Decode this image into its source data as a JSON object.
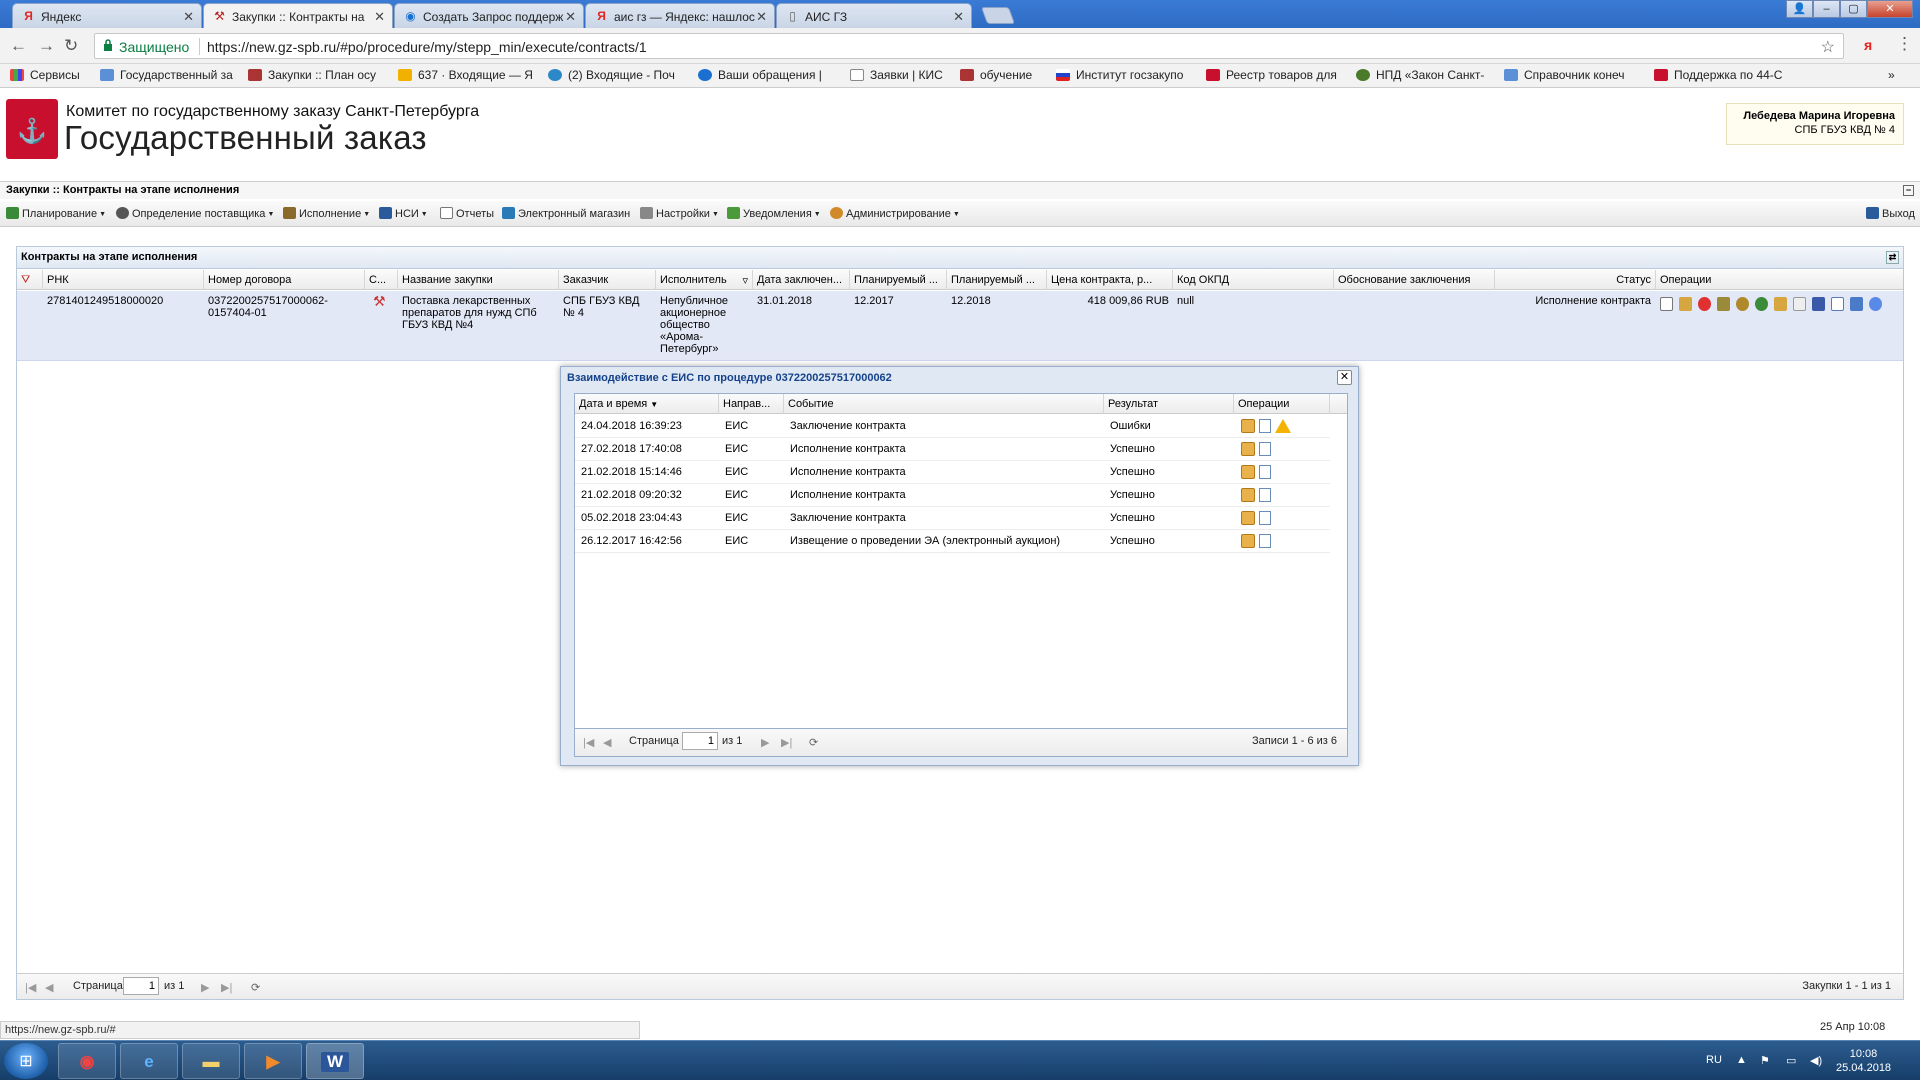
{
  "browser": {
    "tabs": [
      {
        "label": "Яндекс",
        "icon": "yandex-icon"
      },
      {
        "label": "Закупки :: Контракты на",
        "icon": "hammer-icon",
        "active": true
      },
      {
        "label": "Создать Запрос поддерж",
        "icon": "globe-icon"
      },
      {
        "label": "аис гз — Яндекс: нашлоc",
        "icon": "yandex-icon"
      },
      {
        "label": "АИС ГЗ",
        "icon": "page-icon"
      }
    ],
    "address": {
      "secure_label": "Защищено",
      "url": "https://new.gz-spb.ru/#po/procedure/my/stepp_min/execute/contracts/1"
    },
    "bookmarks": [
      "Сервисы",
      "Государственный за",
      "Закупки :: План осу",
      "637 · Входящие — Я",
      "(2) Входящие - Поч",
      "Ваши обращения | ",
      "Заявки | КИС",
      "обучение",
      "Институт госзакупо",
      "Реестр товаров для",
      "НПД «Закон Санкт-",
      "Справочник конеч",
      "Поддержка по 44-С"
    ],
    "status_url": "https://new.gz-spb.ru/#"
  },
  "header": {
    "org_line1": "Комитет по государственному заказу Санкт-Петербурга",
    "org_line2": "Государственный заказ",
    "user_name": "Лебедева Марина Игоревна",
    "user_org": "СПБ ГБУЗ КВД № 4"
  },
  "section_title": "Закупки :: Контракты на этапе исполнения",
  "menu": [
    {
      "label": "Планирование",
      "caret": true
    },
    {
      "label": "Определение поставщика",
      "caret": true
    },
    {
      "label": "Исполнение",
      "caret": true
    },
    {
      "label": "НСИ",
      "caret": true
    },
    {
      "label": "Отчеты",
      "caret": false
    },
    {
      "label": "Электронный магазин",
      "caret": false
    },
    {
      "label": "Настройки",
      "caret": true
    },
    {
      "label": "Уведомления",
      "caret": true
    },
    {
      "label": "Администрирование",
      "caret": true
    }
  ],
  "exit_label": "Выход",
  "main_grid": {
    "title": "Контракты на этапе исполнения",
    "columns": [
      "РНК",
      "Номер договора",
      "С...",
      "Название закупки",
      "Заказчик",
      "Исполнитель",
      "Дата заключен...",
      "Планируемый ...",
      "Планируемый ...",
      "Цена контракта, р...",
      "Код ОКПД",
      "Обоснование заключения",
      "Статус",
      "Операции"
    ],
    "row": {
      "rnk": "2781401249518000020",
      "contract_no": "0372200257517000062-0157404-01",
      "name": "Поставка лекарственных препаратов для нужд СПб ГБУЗ КВД №4",
      "customer": "СПБ ГБУЗ КВД № 4",
      "executor": "Непубличное акционерное общество «Арома-Петербург»",
      "date": "31.01.2018",
      "plan1": "12.2017",
      "plan2": "12.2018",
      "price": "418 009,86 RUB",
      "okpd": "null",
      "status": "Исполнение контракта"
    },
    "pager": {
      "page_label": "Страница",
      "page": "1",
      "of": "из 1",
      "records": "Закупки 1 - 1 из 1"
    }
  },
  "modal": {
    "title": "Взаимодействие с ЕИС по процедуре 0372200257517000062",
    "columns": [
      "Дата и время",
      "Направ...",
      "Событие",
      "Результат",
      "Операции"
    ],
    "rows": [
      {
        "datetime": "24.04.2018 16:39:23",
        "dir": "ЕИС",
        "event": "Заключение контракта",
        "result": "Ошибки",
        "warn": true
      },
      {
        "datetime": "27.02.2018 17:40:08",
        "dir": "ЕИС",
        "event": "Исполнение контракта",
        "result": "Успешно"
      },
      {
        "datetime": "21.02.2018 15:14:46",
        "dir": "ЕИС",
        "event": "Исполнение контракта",
        "result": "Успешно"
      },
      {
        "datetime": "21.02.2018 09:20:32",
        "dir": "ЕИС",
        "event": "Исполнение контракта",
        "result": "Успешно"
      },
      {
        "datetime": "05.02.2018 23:04:43",
        "dir": "ЕИС",
        "event": "Заключение контракта",
        "result": "Успешно"
      },
      {
        "datetime": "26.12.2017 16:42:56",
        "dir": "ЕИС",
        "event": "Извещение о проведении ЭА (электронный аукцион)",
        "result": "Успешно"
      }
    ],
    "pager": {
      "page_label": "Страница",
      "page": "1",
      "of": "из 1",
      "records": "Записи 1 - 6 из 6"
    }
  },
  "date_stamp": "25 Апр 10:08",
  "taskbar": {
    "lang": "RU",
    "time": "10:08",
    "date": "25.04.2018"
  },
  "colors": {
    "accent": "#15428b",
    "selected_row": "#e3e8f7",
    "taskbar": "#1d4a7c"
  }
}
